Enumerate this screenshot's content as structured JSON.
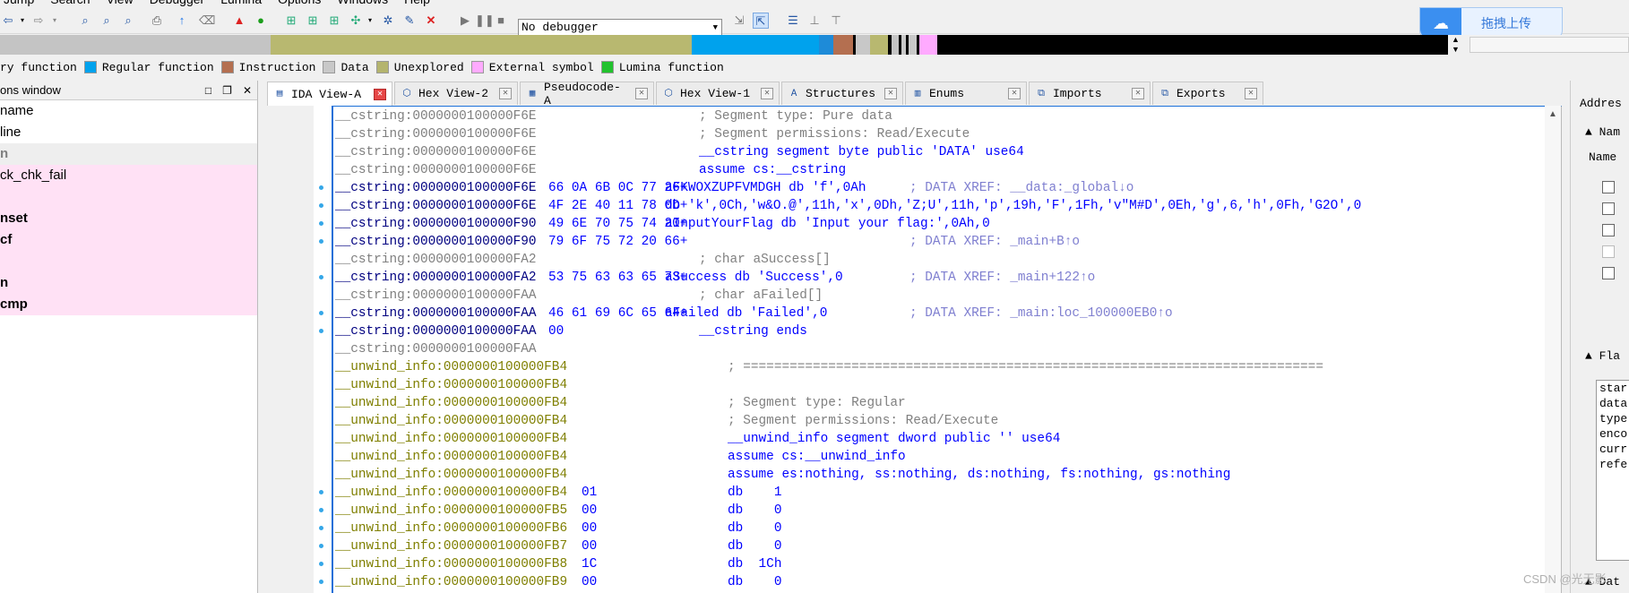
{
  "menu": [
    "Jump",
    "Search",
    "View",
    "Debugger",
    "Lumina",
    "Options",
    "Windows",
    "Help"
  ],
  "toolbar": {
    "debugger_select": "No debugger",
    "upload_label": "拖拽上传"
  },
  "legend": [
    {
      "label": "ry function",
      "color": "#dcdcdc"
    },
    {
      "label": "Regular function",
      "color": "#00a2ed"
    },
    {
      "label": "Instruction",
      "color": "#b46f50"
    },
    {
      "label": "Data",
      "color": "#c8c8c8"
    },
    {
      "label": "Unexplored",
      "color": "#b4b46e"
    },
    {
      "label": "External symbol",
      "color": "#ffaaff"
    },
    {
      "label": "Lumina function",
      "color": "#22c22e"
    }
  ],
  "functions_window": {
    "title": "ons window",
    "header_col": "name",
    "rows": [
      "line",
      "n",
      "ck_chk_fail",
      "",
      "nset",
      "cf",
      "",
      "n",
      "cmp"
    ]
  },
  "tabs": [
    {
      "label": "IDA View-A",
      "icon": "ida-view-icon",
      "active": true
    },
    {
      "label": "Hex View-2",
      "icon": "hex-view-icon"
    },
    {
      "label": "Pseudocode-A",
      "icon": "pseudocode-icon"
    },
    {
      "label": "Hex View-1",
      "icon": "hex-view-icon"
    },
    {
      "label": "Structures",
      "icon": "structures-icon"
    },
    {
      "label": "Enums",
      "icon": "enums-icon"
    },
    {
      "label": "Imports",
      "icon": "imports-icon"
    },
    {
      "label": "Exports",
      "icon": "exports-icon"
    }
  ],
  "disasm": {
    "lines": [
      {
        "addr": "__cstring:0000000100000F6E",
        "bytes": "",
        "code": "; Segment type: Pure data"
      },
      {
        "addr": "__cstring:0000000100000F6E",
        "bytes": "",
        "code": "; Segment permissions: Read/Execute"
      },
      {
        "addr": "__cstring:0000000100000F6E",
        "bytes": "",
        "code": "__cstring segment byte public 'DATA' use64"
      },
      {
        "addr": "__cstring:0000000100000F6E",
        "bytes": "",
        "code": "assume cs:__cstring"
      },
      {
        "addr": "__cstring:0000000100000F6E",
        "bytes": "66 0A 6B 0C 77 26+",
        "code": "aFKWOXZUPFVMDGH db 'f',0Ah",
        "comment": "; DATA XREF: __data:_global↓o"
      },
      {
        "addr": "__cstring:0000000100000F6E",
        "bytes": "4F 2E 40 11 78 0D+",
        "code": "db 'k',0Ch,'w&O.@',11h,'x',0Dh,'Z;U',11h,'p',19h,'F',1Fh,'v\"M#D',0Eh,'g',6,'h',0Fh,'G2O',0"
      },
      {
        "addr": "__cstring:0000000100000F90",
        "bytes": "49 6E 70 75 74 20+",
        "code": "aInputYourFlag db 'Input your flag:',0Ah,0"
      },
      {
        "addr": "__cstring:0000000100000F90",
        "bytes": "79 6F 75 72 20 66+",
        "code": "",
        "comment": "; DATA XREF: _main+B↑o"
      },
      {
        "addr": "__cstring:0000000100000FA2",
        "bytes": "",
        "code": "; char aSuccess[]"
      },
      {
        "addr": "__cstring:0000000100000FA2",
        "bytes": "53 75 63 63 65 73+",
        "code": "aSuccess db 'Success',0",
        "comment": "; DATA XREF: _main+122↑o"
      },
      {
        "addr": "__cstring:0000000100000FAA",
        "bytes": "",
        "code": "; char aFailed[]"
      },
      {
        "addr": "__cstring:0000000100000FAA",
        "bytes": "46 61 69 6C 65 64+",
        "code": "aFailed db 'Failed',0",
        "comment": "; DATA XREF: _main:loc_100000EB0↑o"
      },
      {
        "addr": "__cstring:0000000100000FAA",
        "bytes": "00",
        "code": "__cstring ends"
      },
      {
        "addr": "__cstring:0000000100000FAA",
        "bytes": "",
        "code": ""
      },
      {
        "addr": "__unwind_info:0000000100000FB4",
        "bytes": "",
        "code": "; ==========================================================================="
      },
      {
        "addr": "__unwind_info:0000000100000FB4",
        "bytes": "",
        "code": ""
      },
      {
        "addr": "__unwind_info:0000000100000FB4",
        "bytes": "",
        "code": "; Segment type: Regular"
      },
      {
        "addr": "__unwind_info:0000000100000FB4",
        "bytes": "",
        "code": "; Segment permissions: Read/Execute"
      },
      {
        "addr": "__unwind_info:0000000100000FB4",
        "bytes": "",
        "code": "__unwind_info segment dword public '' use64"
      },
      {
        "addr": "__unwind_info:0000000100000FB4",
        "bytes": "",
        "code": "assume cs:__unwind_info"
      },
      {
        "addr": "__unwind_info:0000000100000FB4",
        "bytes": "",
        "code": "assume es:nothing, ss:nothing, ds:nothing, fs:nothing, gs:nothing"
      },
      {
        "addr": "__unwind_info:0000000100000FB4",
        "bytes": "01",
        "code": "db    1"
      },
      {
        "addr": "__unwind_info:0000000100000FB5",
        "bytes": "00",
        "code": "db    0"
      },
      {
        "addr": "__unwind_info:0000000100000FB6",
        "bytes": "00",
        "code": "db    0"
      },
      {
        "addr": "__unwind_info:0000000100000FB7",
        "bytes": "00",
        "code": "db    0"
      },
      {
        "addr": "__unwind_info:0000000100000FB8",
        "bytes": "1C",
        "code": "db  1Ch"
      },
      {
        "addr": "__unwind_info:0000000100000FB9",
        "bytes": "00",
        "code": "db    0"
      }
    ]
  },
  "right_panel": {
    "address_label": "Addres",
    "name_section": "Nam",
    "name_label": "Name",
    "flags_section": "Fla",
    "flags_text": [
      "star",
      "data",
      "type",
      "enco",
      "curr",
      "refe"
    ],
    "data_section": "Dat"
  },
  "watermark": "CSDN @光无影"
}
